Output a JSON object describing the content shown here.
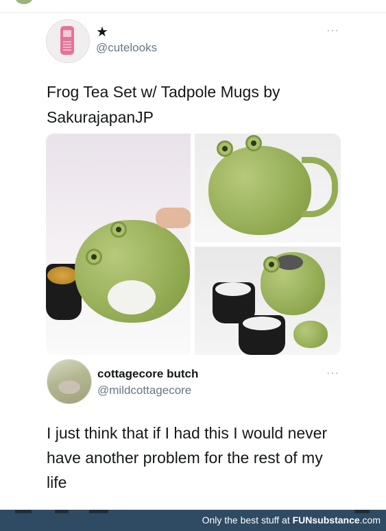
{
  "tweet": {
    "author_badge": "★",
    "handle": "@cutelooks",
    "more": "···",
    "text": "Frog Tea Set w/ Tadpole Mugs by SakurajapanJP"
  },
  "reply": {
    "display_name": "cottagecore butch",
    "handle": "@mildcottagecore",
    "more": "···",
    "text": "I just think that if I had this I would never have another problem for the rest of my life"
  },
  "footer": {
    "tagline": "Only the best stuff at ",
    "brand": "FUNsubstance",
    "suffix": ".com"
  },
  "colors": {
    "footer_bg": "#2f4a63",
    "handle": "#657786",
    "frog_green": "#94ad55"
  }
}
